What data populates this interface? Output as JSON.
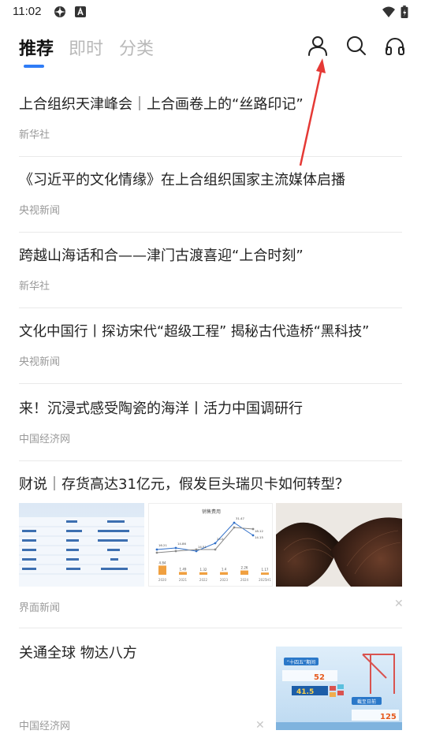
{
  "status_bar": {
    "time": "11:02"
  },
  "tabs": [
    {
      "label": "推荐"
    },
    {
      "label": "即时"
    },
    {
      "label": "分类"
    }
  ],
  "header_icons": [
    "user-icon",
    "search-icon",
    "headphones-icon"
  ],
  "accent_color": "#2f7cf6",
  "news": [
    {
      "title": "上合组织天津峰会｜上合画卷上的“丝路印记”",
      "source": "新华社"
    },
    {
      "title": "《习近平的文化情缘》在上合组织国家主流媒体启播",
      "source": "央视新闻"
    },
    {
      "title": "跨越山海话和合——津门古渡喜迎“上合时刻”",
      "source": "新华社"
    },
    {
      "title": "文化中国行丨探访宋代“超级工程” 揭秘古代造桥“黑科技”",
      "source": "央视新闻"
    },
    {
      "title": "来！沉浸式感受陶瓷的海洋丨活力中国调研行",
      "source": "中国经济网"
    },
    {
      "title": "财说｜存货高达31亿元，假发巨头瑞贝卡如何转型？",
      "source": "界面新闻",
      "thumb_chart": {
        "title": "销售费用",
        "years": [
          "2020",
          "2021",
          "2022",
          "2023",
          "2024",
          "2025H1"
        ],
        "values": [
          "4.84",
          "1.49",
          "1.32",
          "1.4",
          "2.26",
          "1.17"
        ],
        "line_labels": [
          "16.21",
          "14.86",
          "14.51",
          "23.0",
          "31.47",
          "18.12",
          "14.15"
        ]
      }
    },
    {
      "title": "关通全球 物达八方",
      "source": "中国经济网",
      "thumb_text": {
        "badge": "“十四五”期间",
        "big1": "52",
        "big2": "41.5",
        "big3": "125",
        "tag": "截至日前"
      }
    }
  ]
}
